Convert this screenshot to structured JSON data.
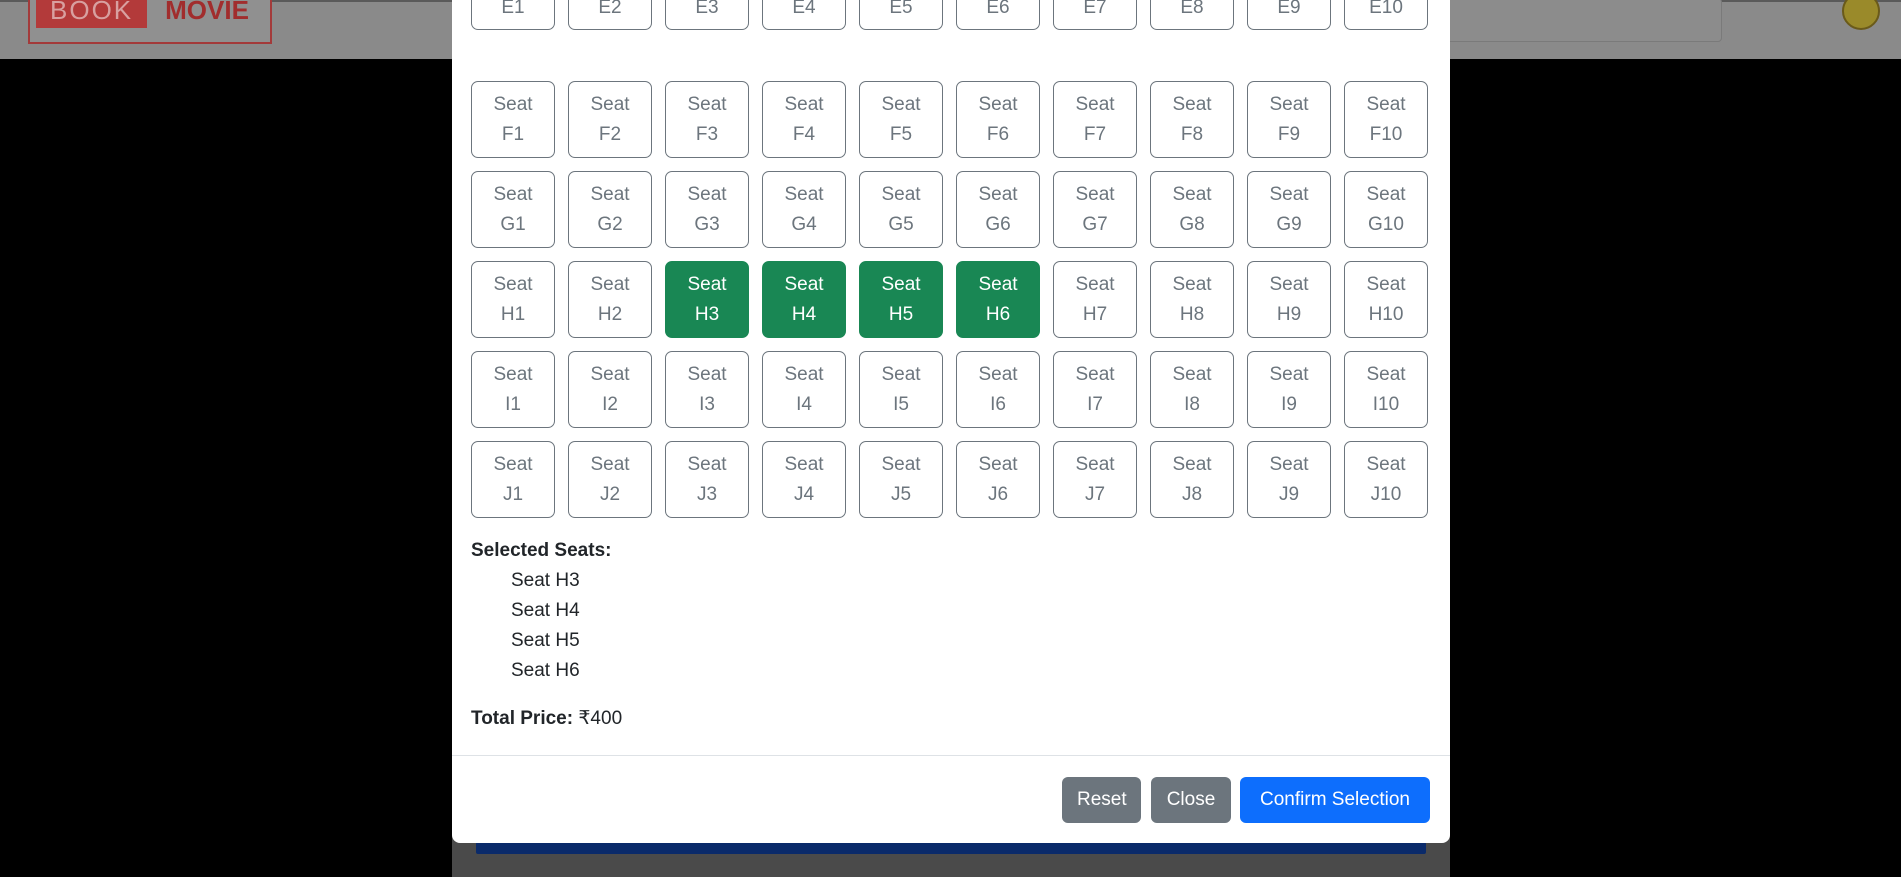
{
  "header": {
    "logo_book": "BOOK",
    "logo_movie": "MOVIE"
  },
  "seats": {
    "partial_row": [
      "E1",
      "E2",
      "E3",
      "E4",
      "E5",
      "E6",
      "E7",
      "E8",
      "E9",
      "E10"
    ],
    "seat_prefix": "Seat",
    "rows": [
      {
        "row": "F",
        "labels": [
          "F1",
          "F2",
          "F3",
          "F4",
          "F5",
          "F6",
          "F7",
          "F8",
          "F9",
          "F10"
        ],
        "selected": []
      },
      {
        "row": "G",
        "labels": [
          "G1",
          "G2",
          "G3",
          "G4",
          "G5",
          "G6",
          "G7",
          "G8",
          "G9",
          "G10"
        ],
        "selected": []
      },
      {
        "row": "H",
        "labels": [
          "H1",
          "H2",
          "H3",
          "H4",
          "H5",
          "H6",
          "H7",
          "H8",
          "H9",
          "H10"
        ],
        "selected": [
          "H3",
          "H4",
          "H5",
          "H6"
        ]
      },
      {
        "row": "I",
        "labels": [
          "I1",
          "I2",
          "I3",
          "I4",
          "I5",
          "I6",
          "I7",
          "I8",
          "I9",
          "I10"
        ],
        "selected": []
      },
      {
        "row": "J",
        "labels": [
          "J1",
          "J2",
          "J3",
          "J4",
          "J5",
          "J6",
          "J7",
          "J8",
          "J9",
          "J10"
        ],
        "selected": []
      }
    ],
    "selected_color": "#198754",
    "default_color": "#6c757d"
  },
  "summary": {
    "selected_title": "Selected Seats:",
    "selected_list": [
      "Seat H3",
      "Seat H4",
      "Seat H5",
      "Seat H6"
    ],
    "total_label": "Total Price:",
    "total_value": "₹400"
  },
  "footer": {
    "reset_label": "Reset",
    "close_label": "Close",
    "confirm_label": "Confirm Selection"
  }
}
